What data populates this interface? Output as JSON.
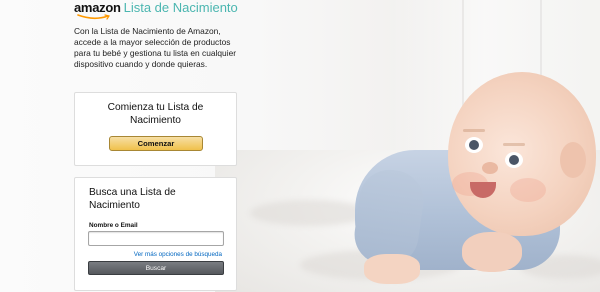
{
  "brand": {
    "logo_text": "amazon",
    "title": "Lista de Nacimiento"
  },
  "intro": {
    "text": "Con la Lista de Nacimiento de Amazon, accede a la mayor selección de productos para tu bebé y gestiona tu lista en cualquier dispositivo cuando y donde quieras."
  },
  "start_card": {
    "title": "Comienza tu Lista de Nacimiento",
    "button_label": "Comenzar"
  },
  "search_card": {
    "title": "Busca una Lista de Nacimiento",
    "field_label": "Nombre o Email",
    "field_value": "",
    "more_options_link": "Ver más opciones de búsqueda",
    "button_label": "Buscar"
  },
  "colors": {
    "brand_accent": "#4bb6b0",
    "primary_button": "#f0c14b",
    "secondary_button": "#55585d",
    "link": "#0066c0"
  },
  "hero_image": {
    "subject": "baby-photo"
  }
}
